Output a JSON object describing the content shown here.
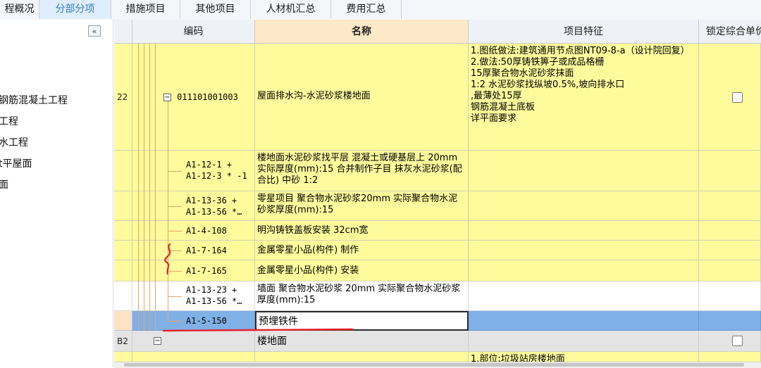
{
  "tabs": [
    {
      "label": "程概况"
    },
    {
      "label": "分部分项"
    },
    {
      "label": "措施项目"
    },
    {
      "label": "其他项目"
    },
    {
      "label": "人材机汇总"
    },
    {
      "label": "费用汇总"
    }
  ],
  "left_tree": {
    "collapse_icon": "«",
    "items": [
      {
        "label": "钢筋混凝土工程"
      },
      {
        "label": "工程"
      },
      {
        "label": "水工程"
      },
      {
        "label": "t平屋面"
      },
      {
        "label": "面"
      }
    ]
  },
  "grid": {
    "headers": {
      "code": "编码",
      "name": "名称",
      "feature": "项目特征",
      "lock": "锁定综合单价"
    },
    "rows": [
      {
        "num": "22",
        "code": "011101001003",
        "expander": "−",
        "name": "屋面排水沟-水泥砂浆楼地面",
        "feature": [
          "1.图纸做法:建筑通用节点图NT09-8-a（设计院回复）",
          "2.做法:50厚铸铁箅子或成品格栅",
          "15厚聚合物水泥砂浆抹面",
          "1:2 水泥砂浆找纵坡0.5%,坡向排水口",
          ",最薄处15厚",
          "钢筋混凝土底板",
          "详平面要求"
        ],
        "locked": false
      },
      {
        "num": "",
        "code": [
          "A1-12-1 +",
          "A1-12-3 * -1"
        ],
        "name": "楼地面水泥砂浆找平层 混凝土或硬基层上 20mm  实际厚度(mm):15  合并制作子目 抹灰水泥砂浆(配合比) 中砂 1:2",
        "feature": [],
        "locked": null
      },
      {
        "num": "",
        "code": [
          "A1-13-36 +",
          "A1-13-56 *…"
        ],
        "name": "零星项目 聚合物水泥砂浆20mm  实际聚合物水泥砂浆厚度(mm):15",
        "feature": [],
        "locked": null
      },
      {
        "num": "",
        "code": [
          "A1-4-108"
        ],
        "name": "明沟铸铁盖板安装 32cm宽",
        "feature": [],
        "locked": null
      },
      {
        "num": "",
        "code": [
          "A1-7-164"
        ],
        "name": "金属零星小品(构件) 制作",
        "feature": [],
        "locked": null
      },
      {
        "num": "",
        "code": [
          "A1-7-165"
        ],
        "name": "金属零星小品(构件) 安装",
        "feature": [],
        "locked": null
      },
      {
        "num": "",
        "code": [
          "A1-13-23 +",
          "A1-13-56 *…"
        ],
        "name": "墙面 聚合物水泥砂浆 20mm  实际聚合物水泥砂浆厚度(mm):15",
        "feature": [],
        "locked": null
      },
      {
        "num": "",
        "code": [
          "A1-5-150"
        ],
        "name": "预埋铁件",
        "feature": [],
        "locked": null
      },
      {
        "num": "B2",
        "code": "",
        "expander": "−",
        "name": "楼地面",
        "feature": [],
        "locked": false
      },
      {
        "num": "",
        "code": "",
        "name": "",
        "feature": [
          "1.部位:垃圾站房楼地面"
        ],
        "locked": null
      }
    ]
  },
  "colors": {
    "active_tab": "#2f7fd1",
    "row_yellow": "#fdfb9c",
    "row_selected": "#7fb0e6",
    "annotation_red": "#e8202a"
  }
}
